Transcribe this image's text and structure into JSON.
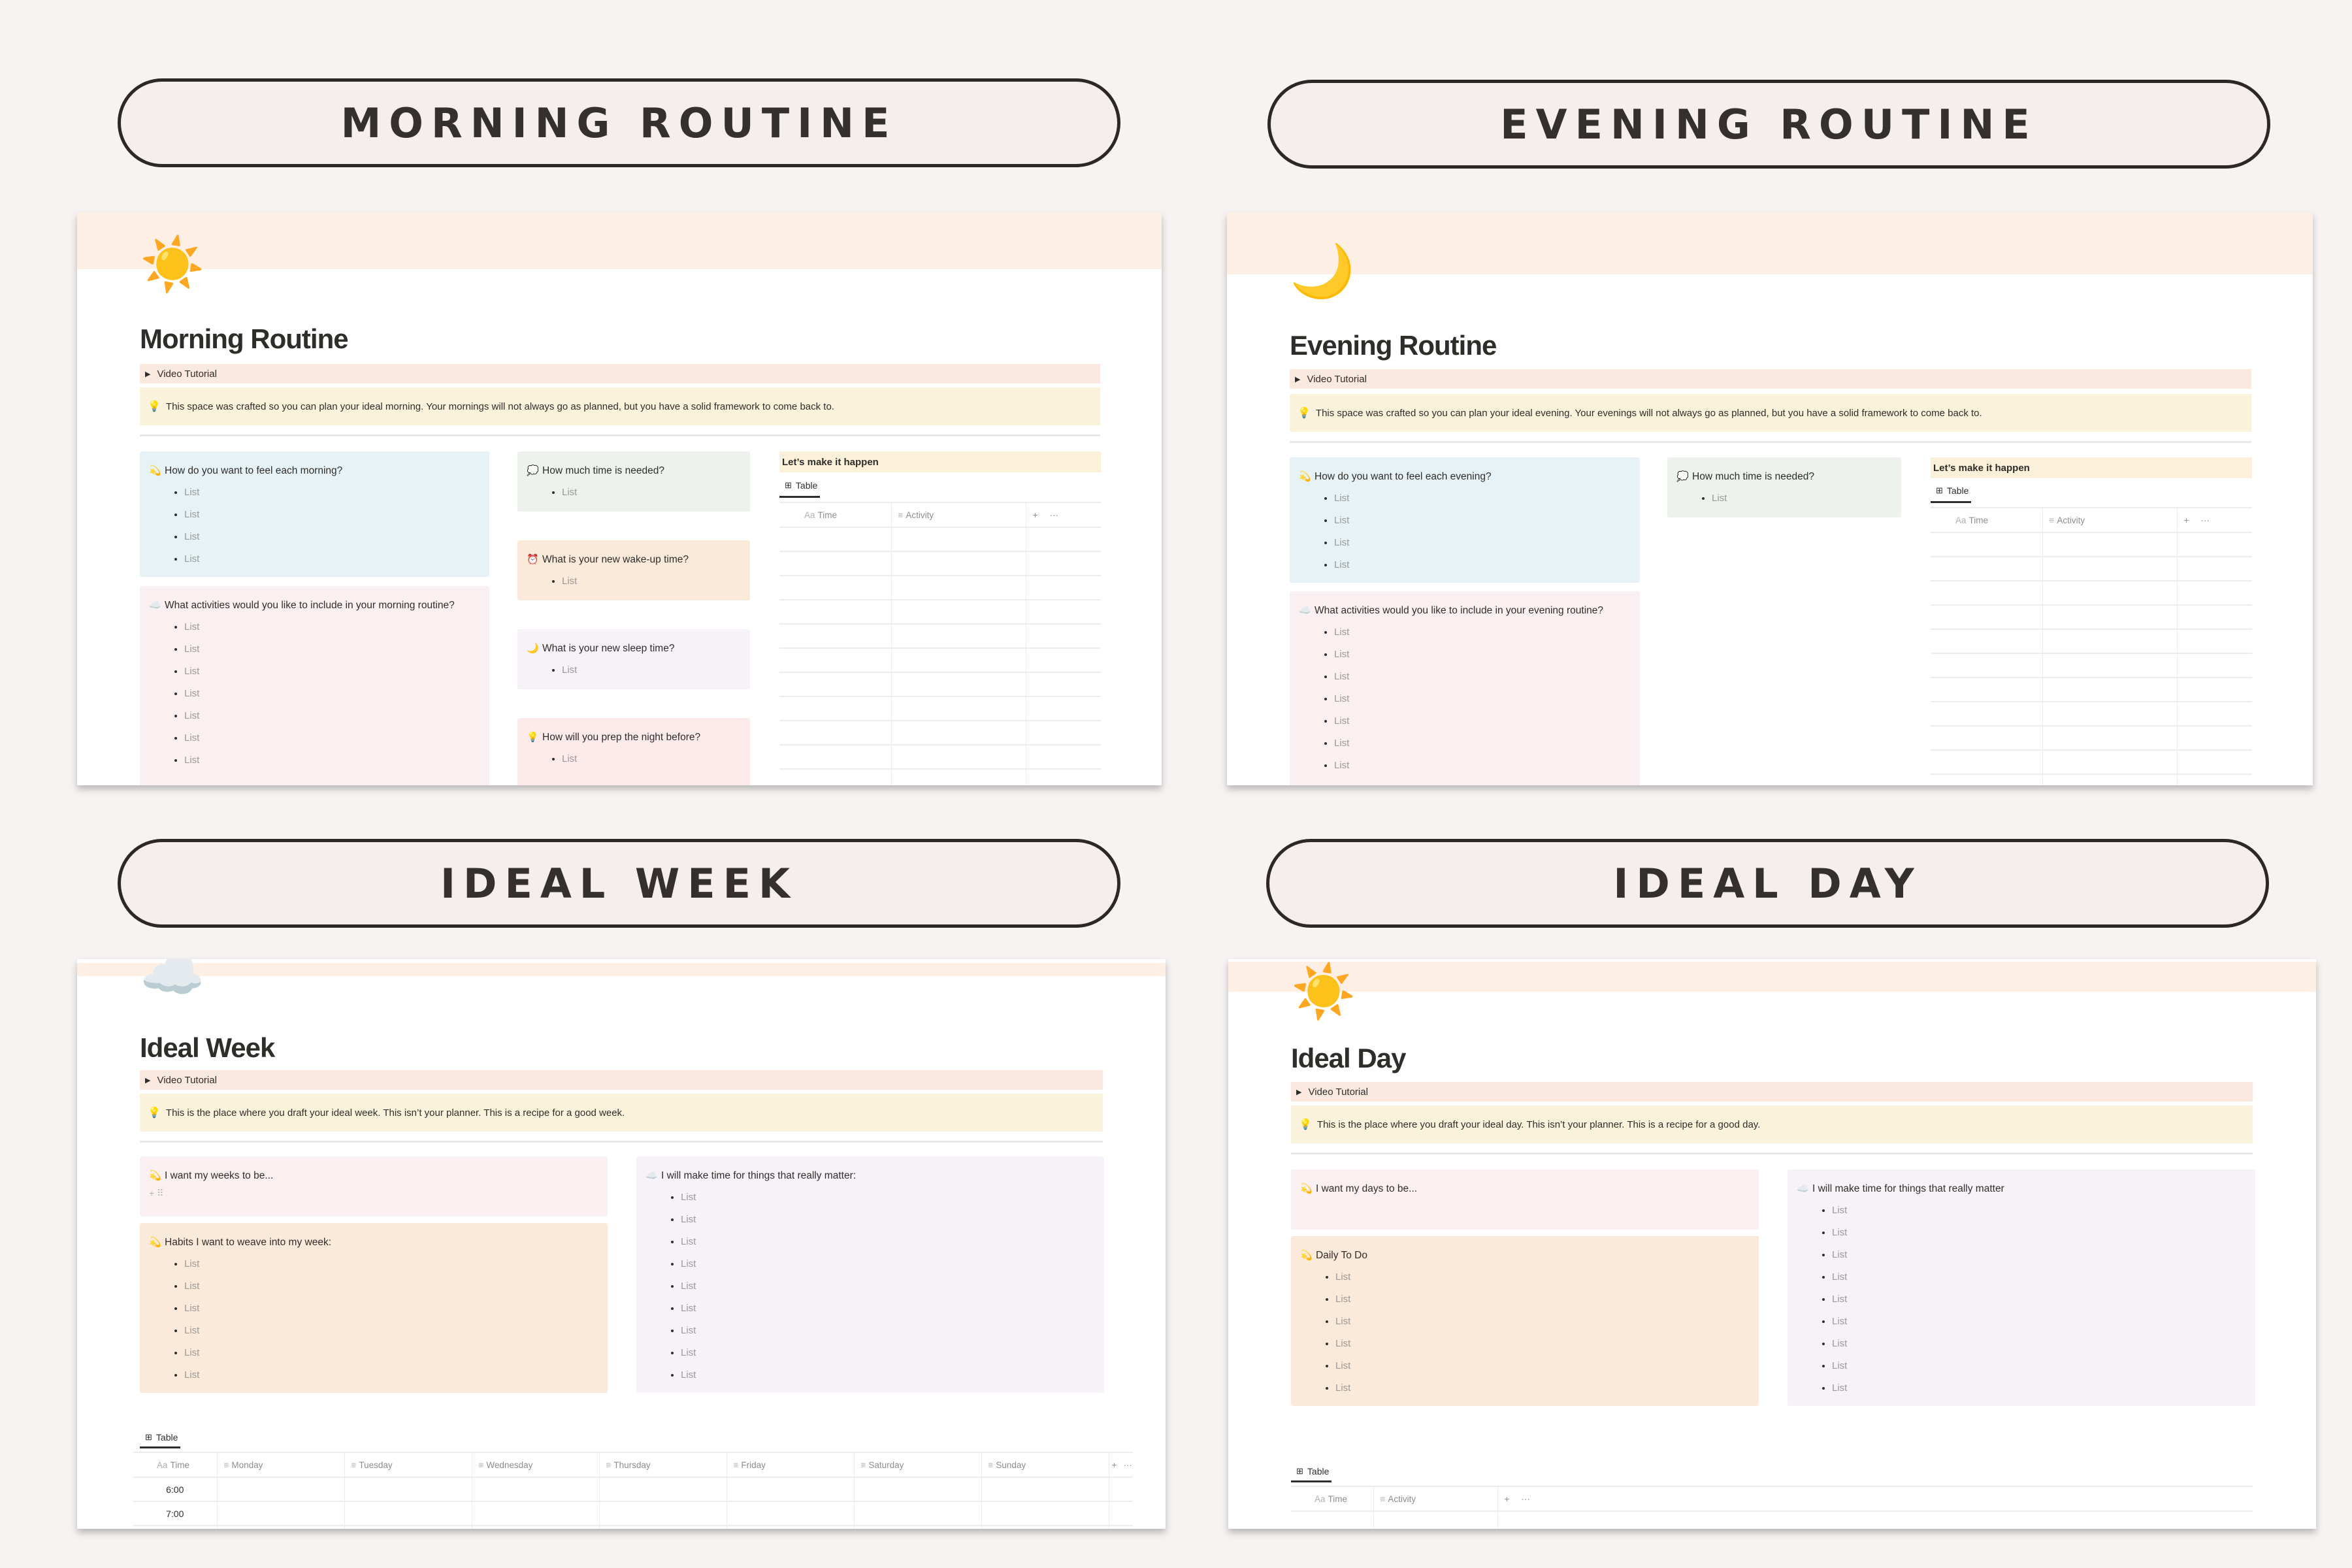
{
  "pills": {
    "morning": "MORNING ROUTINE",
    "evening": "EVENING ROUTINE",
    "week": "IDEAL WEEK",
    "day": "IDEAL DAY"
  },
  "colors": {
    "background": "#f7f3f3",
    "pill_fill": "#f5eeec",
    "pill_border": "#2b2826",
    "banner": "#fdefe3",
    "toggle_bg": "#fbe9df",
    "callout_bg": "#fbf2dc",
    "card_blue": "#e6f2f5",
    "card_pink": "#faf0f2",
    "card_green": "#edf2ec",
    "card_orange": "#fbe9da",
    "card_lavender": "#f6f2f8",
    "card_rose": "#fdeaea"
  },
  "morning": {
    "icon": "sun-icon",
    "icon_glyph": "☀️",
    "title": "Morning Routine",
    "toggle": "Video Tutorial",
    "callout": "This space was crafted so you can plan your ideal morning. Your mornings will not always go as planned, but you have a solid framework to come back to.",
    "cards": [
      {
        "icon": "💫",
        "question": "How do you want to feel each morning?",
        "items": [
          "List",
          "List",
          "List",
          "List"
        ]
      },
      {
        "icon": "☁️",
        "question": "What activities would you like to include in your morning routine?",
        "items": [
          "List",
          "List",
          "List",
          "List",
          "List",
          "List",
          "List"
        ]
      },
      {
        "icon": "💭",
        "question": "How much time is needed?",
        "items": [
          "List"
        ]
      },
      {
        "icon": "⏰",
        "question": "What is your new wake-up time?",
        "items": [
          "List"
        ]
      },
      {
        "icon": "🌙",
        "question": "What is your new sleep time?",
        "items": [
          "List"
        ]
      },
      {
        "icon": "💡",
        "question": "How will you prep the night before?",
        "items": [
          "List"
        ]
      }
    ],
    "heading": "Let’s make it happen",
    "tab": "Table",
    "table": {
      "columns": [
        "Time",
        "Activity"
      ],
      "add": "+",
      "more": "···",
      "empty_rows": 11
    }
  },
  "evening": {
    "icon": "moon-icon",
    "icon_glyph": "🌙",
    "title": "Evening Routine",
    "toggle": "Video Tutorial",
    "callout": "This space was crafted so you can plan your ideal evening. Your evenings will not always go as planned, but you have a solid framework to come back to.",
    "cards": [
      {
        "icon": "💫",
        "question": "How do you want to feel each evening?",
        "items": [
          "List",
          "List",
          "List",
          "List"
        ]
      },
      {
        "icon": "☁️",
        "question": "What activities would you like to include in your evening routine?",
        "items": [
          "List",
          "List",
          "List",
          "List",
          "List",
          "List",
          "List"
        ]
      },
      {
        "icon": "💭",
        "question": "How much time is needed?",
        "items": [
          "List"
        ]
      }
    ],
    "heading": "Let’s make it happen",
    "tab": "Table",
    "table": {
      "columns": [
        "Time",
        "Activity"
      ],
      "add": "+",
      "more": "···",
      "empty_rows": 11
    }
  },
  "week": {
    "icon": "cloud-icon",
    "icon_glyph": "☁️",
    "title": "Ideal Week",
    "toggle": "Video Tutorial",
    "callout": "This is the place where you draft your ideal week. This isn’t your planner. This is a recipe for a good week.",
    "cards": [
      {
        "icon": "💫",
        "question": "I want my weeks to be...",
        "items": [],
        "drag": "+ ⠿"
      },
      {
        "icon": "💫",
        "question": "Habits I want to weave into my week:",
        "items": [
          "List",
          "List",
          "List",
          "List",
          "List",
          "List"
        ]
      },
      {
        "icon": "☁️",
        "question": "I will make time for things that really matter:",
        "items": [
          "List",
          "List",
          "List",
          "List",
          "List",
          "List",
          "List",
          "List",
          "List"
        ]
      }
    ],
    "tab": "Table",
    "table": {
      "columns": [
        "Time",
        "Monday",
        "Tuesday",
        "Wednesday",
        "Thursday",
        "Friday",
        "Saturday",
        "Sunday"
      ],
      "add": "+",
      "more": "···",
      "rows": [
        "6:00",
        "7:00",
        ""
      ]
    }
  },
  "day": {
    "icon": "sun-icon",
    "icon_glyph": "☀️",
    "title": "Ideal Day",
    "toggle": "Video Tutorial",
    "callout": "This is the place where you draft your ideal day. This isn’t your planner. This is a recipe for a good day.",
    "cards": [
      {
        "icon": "💫",
        "question": "I want my days to be...",
        "items": []
      },
      {
        "icon": "💫",
        "question": "Daily To Do",
        "items": [
          "List",
          "List",
          "List",
          "List",
          "List",
          "List"
        ]
      },
      {
        "icon": "☁️",
        "question": "I will make time for things that really matter",
        "items": [
          "List",
          "List",
          "List",
          "List",
          "List",
          "List",
          "List",
          "List",
          "List"
        ]
      }
    ],
    "tab": "Table",
    "table": {
      "columns": [
        "Time",
        "Activity"
      ],
      "add": "+",
      "more": "···",
      "empty_rows": 1
    }
  },
  "labels": {
    "aa": "Aa",
    "lines": "≡",
    "bullet_toggle": "▸",
    "bulb": "💡",
    "table_icon": "⊞"
  }
}
